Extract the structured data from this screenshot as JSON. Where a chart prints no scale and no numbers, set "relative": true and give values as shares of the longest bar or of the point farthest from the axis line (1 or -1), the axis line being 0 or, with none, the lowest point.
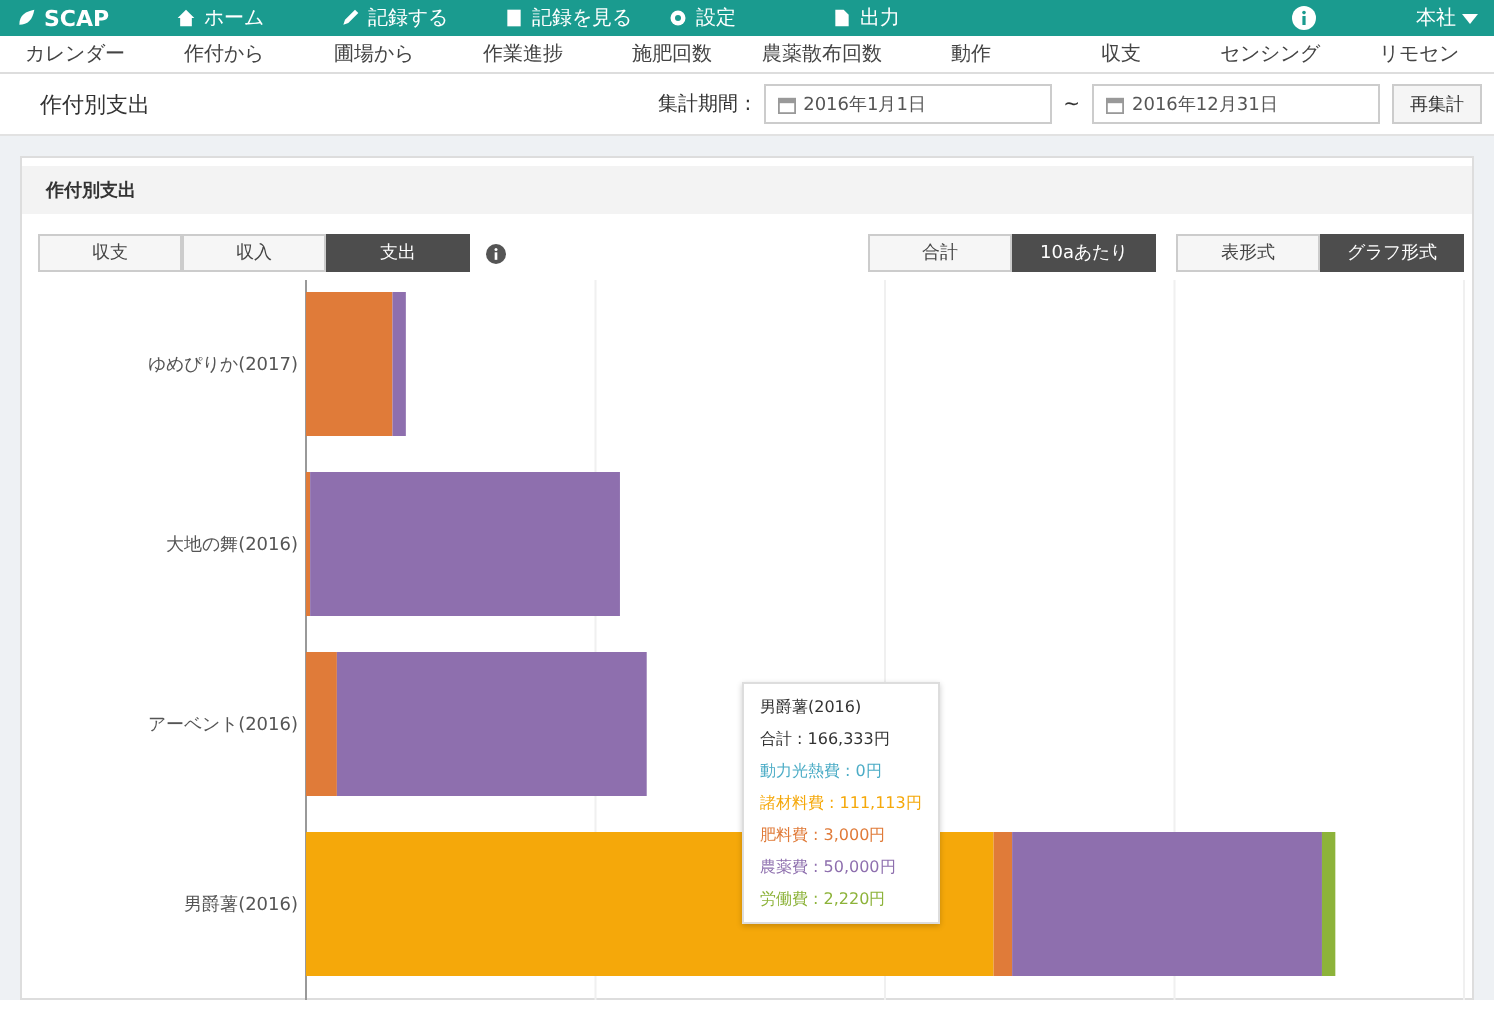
{
  "topbar": {
    "brand": "SCAP",
    "items": [
      {
        "label": "ホーム"
      },
      {
        "label": "記録する"
      },
      {
        "label": "記録を見る"
      },
      {
        "label": "設定"
      },
      {
        "label": "出力"
      }
    ],
    "user": "本社"
  },
  "subnav": [
    "カレンダー",
    "作付から",
    "圃場から",
    "作業進捗",
    "施肥回数",
    "農薬散布回数",
    "動作",
    "収支",
    "センシング",
    "リモセン"
  ],
  "page": {
    "title": "作付別支出",
    "period_label": "集計期間 :",
    "date_from": "2016年1月1日",
    "separator": "~",
    "date_to": "2016年12月31日",
    "recalc_button": "再集計"
  },
  "panel": {
    "title": "作付別支出",
    "type_tabs": [
      {
        "label": "収支",
        "selected": false
      },
      {
        "label": "収入",
        "selected": false
      },
      {
        "label": "支出",
        "selected": true
      }
    ],
    "unit_tabs": [
      {
        "label": "合計",
        "selected": false
      },
      {
        "label": "10aあたり",
        "selected": true
      }
    ],
    "view_tabs": [
      {
        "label": "表形式",
        "selected": false
      },
      {
        "label": "グラフ形式",
        "selected": true
      }
    ],
    "chart_data": {
      "type": "bar",
      "orientation": "horizontal",
      "stacked": true,
      "categories": [
        "ゆめぴりか(2017)",
        "大地の舞(2016)",
        "アーベント(2016)",
        "男爵薯(2016)"
      ],
      "relative": true,
      "series": [
        {
          "color": "#f5a80a",
          "values": [
            null,
            null,
            null,
            0.668
          ]
        },
        {
          "color": "#e07b39",
          "values": [
            0.084,
            0.004,
            0.03,
            0.018
          ]
        },
        {
          "color": "#8e6fae",
          "values": [
            0.013,
            0.301,
            0.301,
            0.301
          ]
        },
        {
          "color": "#8db33a",
          "values": [
            null,
            null,
            null,
            0.013
          ]
        }
      ]
    },
    "tooltip": {
      "title": "男爵薯(2016)",
      "total": "合計 : 166,333円",
      "items": [
        {
          "label": "動力光熱費 : 0円",
          "color": "#4bacc6"
        },
        {
          "label": "諸材料費 : 111,113円",
          "color": "#f5a80a"
        },
        {
          "label": "肥料費 : 3,000円",
          "color": "#e07b39"
        },
        {
          "label": "農薬費 : 50,000円",
          "color": "#8e6fae"
        },
        {
          "label": "労働費 : 2,220円",
          "color": "#8db33a"
        }
      ]
    }
  }
}
